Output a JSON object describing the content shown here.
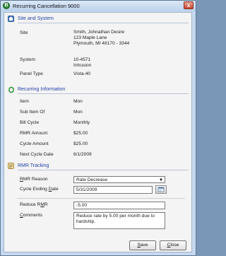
{
  "window": {
    "title": "Recurring Cancellation 9000",
    "app_icon": "B",
    "close_glyph": "x"
  },
  "site_section": {
    "title": "Site and System",
    "site_label": "Site",
    "site_name": "Smith, Johnathan  Desire",
    "site_address1": "123 Maple Lane",
    "site_address2": "Plymouth, MI  48170 - 3344",
    "system_label": "System",
    "system_id": "10-4571",
    "system_type": "Intrusion",
    "panel_label": "Panel Type",
    "panel_value": "Vista-40"
  },
  "recurring_section": {
    "title": "Recurring Information",
    "rows": [
      {
        "label": "Item",
        "value": "Mon"
      },
      {
        "label": "Sub Item Of",
        "value": "Mon"
      },
      {
        "label": "Bill Cycle",
        "value": "Monthly"
      },
      {
        "label": "RMR Amount",
        "value": "$25.00"
      },
      {
        "label": "Cycle Amount",
        "value": "$25.00"
      },
      {
        "label": "Next Cycle Date",
        "value": "6/1/2009"
      }
    ]
  },
  "rmr_section": {
    "title": "RMR Tracking",
    "reason_label_pre": "",
    "reason_label_u": "R",
    "reason_label_post": "MR Reason",
    "reason_value": "Rate Decrease",
    "ending_label_pre": "Cycle Ending ",
    "ending_label_u": "D",
    "ending_label_post": "ate",
    "ending_value": "5/31/2009",
    "reduce_label_pre": "Reduce R",
    "reduce_label_u": "M",
    "reduce_label_post": "R",
    "reduce_value": "-5.00",
    "comments_label_pre": "",
    "comments_label_u": "C",
    "comments_label_post": "omments",
    "comments_value": "Reduce rate by 5.00 per month due to hardship."
  },
  "buttons": {
    "save_pre": "",
    "save_u": "S",
    "save_post": "ave",
    "close_pre": "",
    "close_u": "C",
    "close_post": "lose"
  },
  "colors": {
    "section_title": "#2342a8",
    "window_frame": "#c6d9ef",
    "client_bg": "#f4f4f4"
  },
  "icons": {
    "site": "site-icon",
    "recurring": "recurring-icon",
    "rmr": "rmr-tracking-icon",
    "calendar": "calendar-icon",
    "dropdown": "chevron-down-icon"
  }
}
